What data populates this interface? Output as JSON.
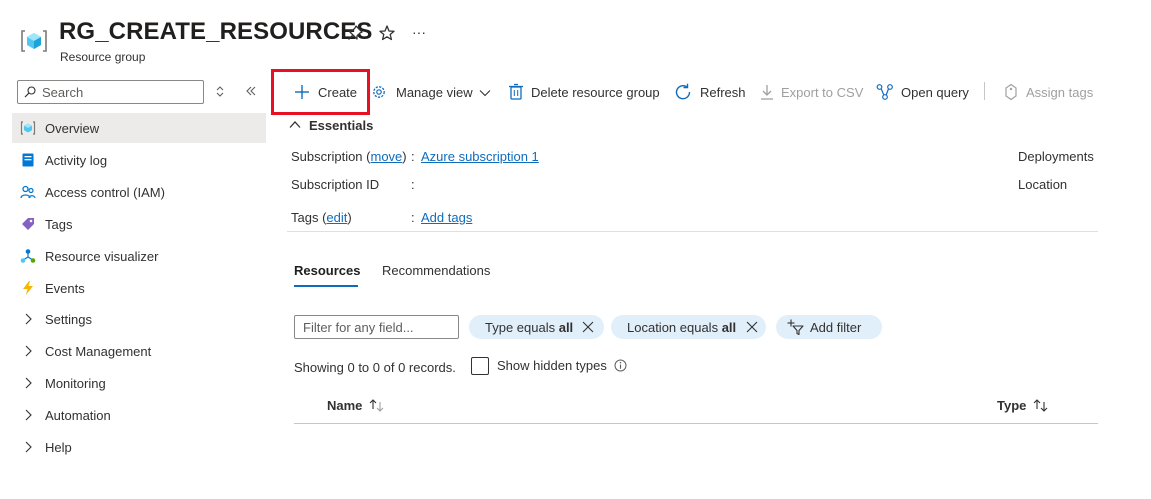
{
  "header": {
    "title": "RG_CREATE_RESOURCES",
    "subtitle": "Resource group",
    "icons": [
      "resource-group-icon",
      "pin-icon",
      "star-icon",
      "more-icon"
    ],
    "more_glyph": "···"
  },
  "sidebar": {
    "search_placeholder": "Search",
    "items": [
      {
        "label": "Overview",
        "icon": "overview-icon",
        "selected": true
      },
      {
        "label": "Activity log",
        "icon": "activity-log-icon"
      },
      {
        "label": "Access control (IAM)",
        "icon": "people-icon"
      },
      {
        "label": "Tags",
        "icon": "tag-icon"
      },
      {
        "label": "Resource visualizer",
        "icon": "visualizer-icon"
      },
      {
        "label": "Events",
        "icon": "lightning-icon"
      },
      {
        "label": "Settings",
        "icon": "chevron-right-icon"
      },
      {
        "label": "Cost Management",
        "icon": "chevron-right-icon"
      },
      {
        "label": "Monitoring",
        "icon": "chevron-right-icon"
      },
      {
        "label": "Automation",
        "icon": "chevron-right-icon"
      },
      {
        "label": "Help",
        "icon": "chevron-right-icon"
      }
    ]
  },
  "toolbar": {
    "create": "Create",
    "manage_view": "Manage view",
    "delete": "Delete resource group",
    "refresh": "Refresh",
    "export": "Export to CSV",
    "open_query": "Open query",
    "assign_tags": "Assign tags"
  },
  "essentials": {
    "toggle_label": "Essentials",
    "subscription_label": "Subscription",
    "move_link": "move",
    "subscription_value": "Azure subscription 1",
    "subscription_id_label": "Subscription ID",
    "tags_label": "Tags",
    "edit_link": "edit",
    "tags_value": "Add tags",
    "colon": ":",
    "deployments_label": "Deployments",
    "location_label": "Location"
  },
  "tabs": [
    {
      "label": "Resources",
      "active": true
    },
    {
      "label": "Recommendations",
      "active": false
    }
  ],
  "filters": {
    "input_placeholder": "Filter for any field...",
    "pill_type_prefix": "Type equals ",
    "pill_type_value": "all",
    "pill_location_prefix": "Location equals ",
    "pill_location_value": "all",
    "add_filter": "Add filter"
  },
  "records": {
    "text": "Showing 0 to 0 of 0 records.",
    "show_hidden_label": "Show hidden types",
    "show_hidden_checked": false
  },
  "table": {
    "columns": [
      "Name",
      "Type"
    ]
  },
  "colors": {
    "accent": "#0f6cbd",
    "highlight": "#e81123",
    "pill_bg": "#e1effa",
    "selected_bg": "#edebe9"
  }
}
